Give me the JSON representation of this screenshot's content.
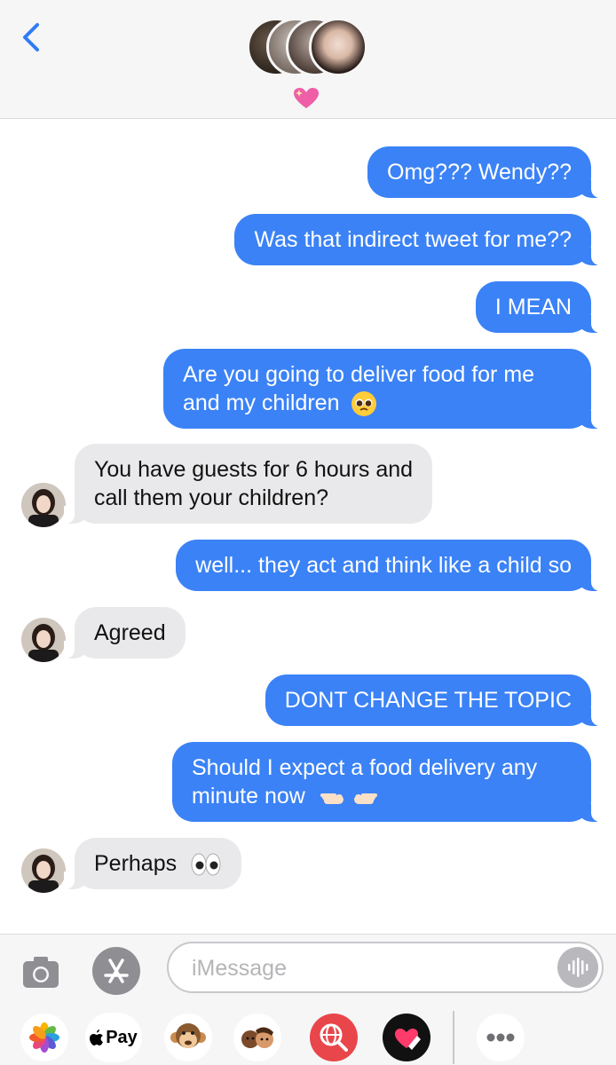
{
  "header": {
    "back_label": "Back",
    "contact_icon": "group-avatar-stack",
    "status_emoji": "sparkling-heart"
  },
  "messages": [
    {
      "side": "out",
      "text": "Omg??? Wendy??"
    },
    {
      "side": "out",
      "text": "Was that indirect tweet for me??"
    },
    {
      "side": "out",
      "text": "I MEAN"
    },
    {
      "side": "out",
      "line1": "Are you going to deliver food for me",
      "line2": "and my children",
      "emoji": "pleading-face"
    },
    {
      "side": "in",
      "line1": "You have guests for 6 hours and",
      "line2": "call them your children?"
    },
    {
      "side": "out",
      "text": "well... they act and think like a child so"
    },
    {
      "side": "in",
      "text": "Agreed"
    },
    {
      "side": "out",
      "text": "DONT CHANGE THE TOPIC"
    },
    {
      "side": "out",
      "line1": "Should I expect a food delivery any",
      "line2": "minute now",
      "emoji": "pointing-hands"
    },
    {
      "side": "in",
      "text": "Perhaps",
      "emoji": "eyes"
    }
  ],
  "composer": {
    "placeholder": "iMessage",
    "camera_icon": "camera-icon",
    "appstore_icon": "app-store-icon",
    "mic_icon": "audio-waveform-icon"
  },
  "app_drawer": [
    {
      "name": "photos",
      "label": ""
    },
    {
      "name": "apple-pay",
      "label": "Pay"
    },
    {
      "name": "animoji-monkey",
      "label": ""
    },
    {
      "name": "memoji-stickers",
      "label": ""
    },
    {
      "name": "web-image-search",
      "label": ""
    },
    {
      "name": "digital-touch",
      "label": ""
    },
    {
      "name": "more",
      "label": ""
    }
  ],
  "colors": {
    "outgoing_bubble": "#3b82f6",
    "incoming_bubble": "#e9e9eb",
    "accent": "#2f7cf6"
  }
}
